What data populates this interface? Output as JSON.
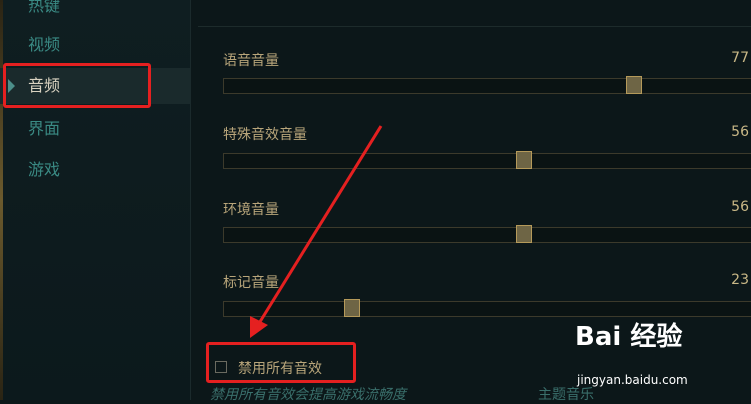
{
  "sidebar": {
    "items": [
      {
        "label": "热键"
      },
      {
        "label": "视频"
      },
      {
        "label": "音频"
      },
      {
        "label": "界面"
      },
      {
        "label": "游戏"
      }
    ],
    "active_index": 2
  },
  "audio": {
    "sliders": [
      {
        "label": "语音音量",
        "value": "77",
        "fraction": 0.77
      },
      {
        "label": "特殊音效音量",
        "value": "56",
        "fraction": 0.56
      },
      {
        "label": "环境音量",
        "value": "56",
        "fraction": 0.56
      },
      {
        "label": "标记音量",
        "value": "23",
        "fraction": 0.23
      }
    ],
    "disable_all": {
      "label": "禁用所有音效",
      "checked": false
    },
    "hint": "禁用所有音效会提高游戏流畅度",
    "theme_music": "主题音乐"
  },
  "watermark": {
    "brand": "Bai 经验",
    "url": "jingyan.baidu.com"
  },
  "colors": {
    "background": "#0c1719",
    "label_gold": "#b8a57a",
    "nav_teal": "#3a8a84",
    "annotation_red": "#e52020"
  }
}
